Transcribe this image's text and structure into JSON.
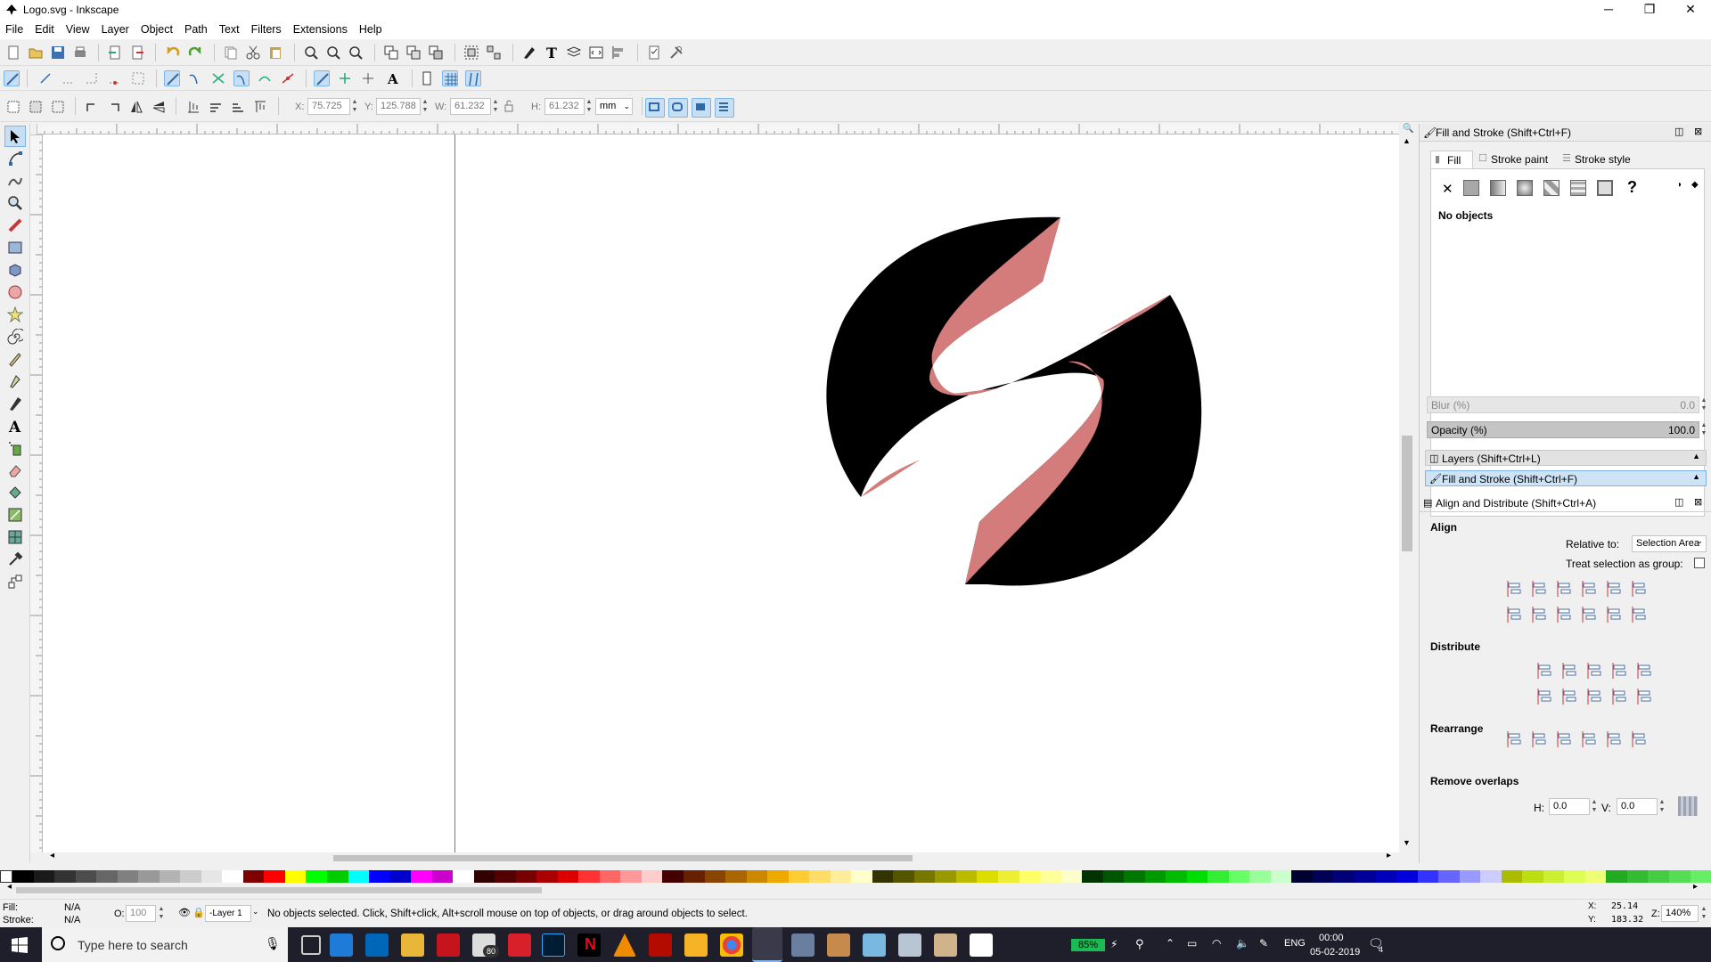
{
  "window": {
    "title": "Logo.svg - Inkscape",
    "minimize_glyph": "─",
    "maximize_glyph": "❐",
    "close_glyph": "✕"
  },
  "menu": [
    "File",
    "Edit",
    "View",
    "Layer",
    "Object",
    "Path",
    "Text",
    "Filters",
    "Extensions",
    "Help"
  ],
  "toolbar_controls": {
    "x_label": "X:",
    "x_value": "75.725",
    "y_label": "Y:",
    "y_value": "125.788",
    "w_label": "W:",
    "w_value": "61.232",
    "h_label": "H:",
    "h_value": "61.232",
    "unit": "mm"
  },
  "fill_stroke": {
    "header": "Fill and Stroke (Shift+Ctrl+F)",
    "tab_fill": "Fill",
    "tab_stroke_paint": "Stroke paint",
    "tab_stroke_style": "Stroke style",
    "no_objects": "No objects",
    "blur_label": "Blur (%)",
    "blur_value": "0.0",
    "opacity_label": "Opacity (%)",
    "opacity_value": "100.0",
    "unset_glyph": "✕",
    "unknown_glyph": "?"
  },
  "layers_header": "Layers (Shift+Ctrl+L)",
  "fill_stroke_collapsed": "Fill and Stroke (Shift+Ctrl+F)",
  "align": {
    "header": "Align and Distribute (Shift+Ctrl+A)",
    "align_title": "Align",
    "relative_to_label": "Relative to:",
    "relative_to_value": "Selection Area",
    "treat_as_group": "Treat selection as group:",
    "distribute_title": "Distribute",
    "rearrange_title": "Rearrange",
    "remove_overlaps_title": "Remove overlaps",
    "h_label": "H:",
    "h_value": "0.0",
    "v_label": "V:",
    "v_value": "0.0"
  },
  "statusbar": {
    "fill_label": "Fill:",
    "fill_value": "N/A",
    "stroke_label": "Stroke:",
    "stroke_value": "N/A",
    "opacity_label": "O:",
    "opacity_value": "100",
    "layer": "-Layer 1",
    "message": "No objects selected. Click, Shift+click, Alt+scroll mouse on top of objects, or drag around objects to select.",
    "cursor_x_label": "X:",
    "cursor_x": "25.14",
    "cursor_y_label": "Y:",
    "cursor_y": "183.32",
    "zoom_label": "Z:",
    "zoom": "140%"
  },
  "taskbar": {
    "search_placeholder": "Type here to search",
    "battery": "85%",
    "language": "ENG",
    "time": "00:00",
    "date": "05-02-2019",
    "mail_badge": "80",
    "notification_count": "4"
  },
  "colors": {
    "logo_black": "#000000",
    "logo_pink": "#d47b7b",
    "accent_blue": "#7eb4ea"
  }
}
